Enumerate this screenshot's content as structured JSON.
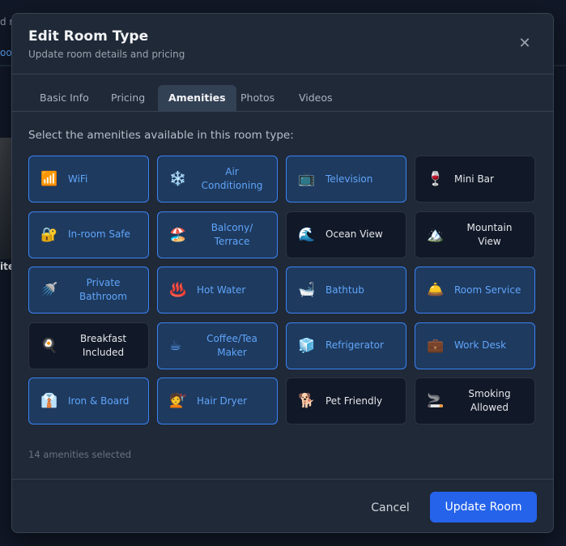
{
  "background": {
    "fragment_top": "d m",
    "fragment_tab": "oo",
    "fragment_side": "ite"
  },
  "modal": {
    "title": "Edit Room Type",
    "subtitle": "Update room details and pricing",
    "close_label": "✕"
  },
  "tabs": [
    {
      "label": "Basic Info",
      "active": false
    },
    {
      "label": "Pricing",
      "active": false
    },
    {
      "label": "Amenities",
      "active": true
    },
    {
      "label": "Photos",
      "active": false
    },
    {
      "label": "Videos",
      "active": false
    }
  ],
  "amenities": {
    "prompt": "Select the amenities available in this room type:",
    "items": [
      {
        "label": "WiFi",
        "icon": "📶",
        "selected": true
      },
      {
        "label": "Air Conditioning",
        "icon": "❄️",
        "selected": true
      },
      {
        "label": "Television",
        "icon": "📺",
        "selected": true
      },
      {
        "label": "Mini Bar",
        "icon": "🍷",
        "selected": false
      },
      {
        "label": "In-room Safe",
        "icon": "🔐",
        "selected": true
      },
      {
        "label": "Balcony/ Terrace",
        "icon": "🏖️",
        "selected": true
      },
      {
        "label": "Ocean View",
        "icon": "🌊",
        "selected": false
      },
      {
        "label": "Mountain View",
        "icon": "🏔️",
        "selected": false
      },
      {
        "label": "Private Bathroom",
        "icon": "🚿",
        "selected": true
      },
      {
        "label": "Hot Water",
        "icon": "♨️",
        "selected": true
      },
      {
        "label": "Bathtub",
        "icon": "🛁",
        "selected": true
      },
      {
        "label": "Room Service",
        "icon": "🛎️",
        "selected": true
      },
      {
        "label": "Breakfast Included",
        "icon": "🍳",
        "selected": false
      },
      {
        "label": "Coffee/Tea Maker",
        "icon": "☕",
        "selected": true
      },
      {
        "label": "Refrigerator",
        "icon": "🧊",
        "selected": true
      },
      {
        "label": "Work Desk",
        "icon": "💼",
        "selected": true
      },
      {
        "label": "Iron & Board",
        "icon": "👔",
        "selected": true
      },
      {
        "label": "Hair Dryer",
        "icon": "💇",
        "selected": true
      },
      {
        "label": "Pet Friendly",
        "icon": "🐕",
        "selected": false
      },
      {
        "label": "Smoking Allowed",
        "icon": "🚬",
        "selected": false
      }
    ],
    "count_text": "14 amenities selected"
  },
  "footer": {
    "cancel_label": "Cancel",
    "submit_label": "Update Room"
  },
  "colors": {
    "accent": "#2563eb",
    "selected_bg": "#1e3a5f",
    "selected_text": "#60a5fa"
  }
}
